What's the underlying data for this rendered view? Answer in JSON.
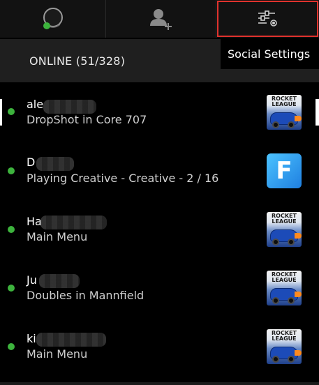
{
  "tabs": {
    "status_icon": "avatar-status-icon",
    "add_friend_icon": "add-friend-icon",
    "settings_icon": "social-settings-icon"
  },
  "tooltip": {
    "label": "Social Settings"
  },
  "section": {
    "label": "ONLINE (51/328)"
  },
  "friends": [
    {
      "name_visible": "ale",
      "activity": "DropShot in Core 707",
      "game_icon": "rocket-league-icon",
      "game_logo": "ROCKET LEAGUE"
    },
    {
      "name_visible": "D",
      "activity": "Playing Creative - Creative - 2 / 16",
      "game_icon": "fortnite-icon",
      "game_logo": "F"
    },
    {
      "name_visible": "Ha",
      "activity": "Main Menu",
      "game_icon": "rocket-league-icon",
      "game_logo": "ROCKET LEAGUE"
    },
    {
      "name_visible": "Ju",
      "activity": "Doubles in Mannfield",
      "game_icon": "rocket-league-icon",
      "game_logo": "ROCKET LEAGUE"
    },
    {
      "name_visible": "ki",
      "activity": "Main Menu",
      "game_icon": "rocket-league-icon",
      "game_logo": "ROCKET LEAGUE"
    }
  ],
  "colors": {
    "online": "#3db33d",
    "highlight_border": "#e0322d",
    "background": "#000000",
    "header_bg": "#1f1f1f"
  }
}
